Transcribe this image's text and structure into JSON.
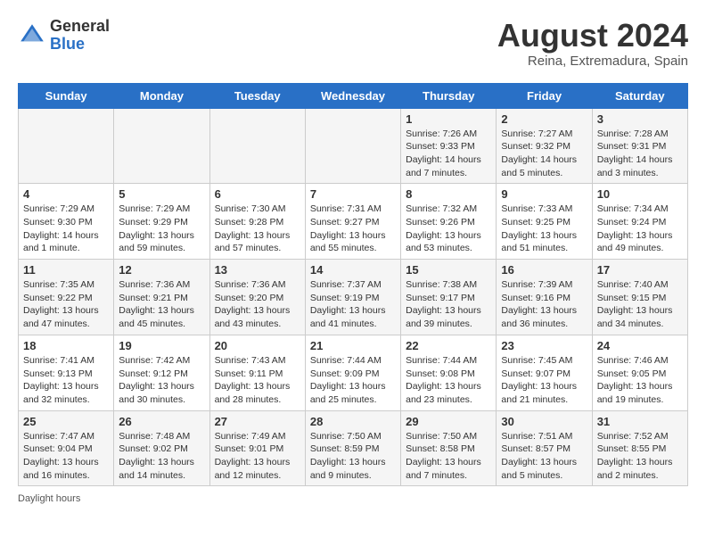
{
  "header": {
    "logo": {
      "general": "General",
      "blue": "Blue"
    },
    "title": "August 2024",
    "location": "Reina, Extremadura, Spain"
  },
  "days_of_week": [
    "Sunday",
    "Monday",
    "Tuesday",
    "Wednesday",
    "Thursday",
    "Friday",
    "Saturday"
  ],
  "weeks": [
    [
      {
        "day": "",
        "info": ""
      },
      {
        "day": "",
        "info": ""
      },
      {
        "day": "",
        "info": ""
      },
      {
        "day": "",
        "info": ""
      },
      {
        "day": "1",
        "info": "Sunrise: 7:26 AM\nSunset: 9:33 PM\nDaylight: 14 hours\nand 7 minutes."
      },
      {
        "day": "2",
        "info": "Sunrise: 7:27 AM\nSunset: 9:32 PM\nDaylight: 14 hours\nand 5 minutes."
      },
      {
        "day": "3",
        "info": "Sunrise: 7:28 AM\nSunset: 9:31 PM\nDaylight: 14 hours\nand 3 minutes."
      }
    ],
    [
      {
        "day": "4",
        "info": "Sunrise: 7:29 AM\nSunset: 9:30 PM\nDaylight: 14 hours\nand 1 minute."
      },
      {
        "day": "5",
        "info": "Sunrise: 7:29 AM\nSunset: 9:29 PM\nDaylight: 13 hours\nand 59 minutes."
      },
      {
        "day": "6",
        "info": "Sunrise: 7:30 AM\nSunset: 9:28 PM\nDaylight: 13 hours\nand 57 minutes."
      },
      {
        "day": "7",
        "info": "Sunrise: 7:31 AM\nSunset: 9:27 PM\nDaylight: 13 hours\nand 55 minutes."
      },
      {
        "day": "8",
        "info": "Sunrise: 7:32 AM\nSunset: 9:26 PM\nDaylight: 13 hours\nand 53 minutes."
      },
      {
        "day": "9",
        "info": "Sunrise: 7:33 AM\nSunset: 9:25 PM\nDaylight: 13 hours\nand 51 minutes."
      },
      {
        "day": "10",
        "info": "Sunrise: 7:34 AM\nSunset: 9:24 PM\nDaylight: 13 hours\nand 49 minutes."
      }
    ],
    [
      {
        "day": "11",
        "info": "Sunrise: 7:35 AM\nSunset: 9:22 PM\nDaylight: 13 hours\nand 47 minutes."
      },
      {
        "day": "12",
        "info": "Sunrise: 7:36 AM\nSunset: 9:21 PM\nDaylight: 13 hours\nand 45 minutes."
      },
      {
        "day": "13",
        "info": "Sunrise: 7:36 AM\nSunset: 9:20 PM\nDaylight: 13 hours\nand 43 minutes."
      },
      {
        "day": "14",
        "info": "Sunrise: 7:37 AM\nSunset: 9:19 PM\nDaylight: 13 hours\nand 41 minutes."
      },
      {
        "day": "15",
        "info": "Sunrise: 7:38 AM\nSunset: 9:17 PM\nDaylight: 13 hours\nand 39 minutes."
      },
      {
        "day": "16",
        "info": "Sunrise: 7:39 AM\nSunset: 9:16 PM\nDaylight: 13 hours\nand 36 minutes."
      },
      {
        "day": "17",
        "info": "Sunrise: 7:40 AM\nSunset: 9:15 PM\nDaylight: 13 hours\nand 34 minutes."
      }
    ],
    [
      {
        "day": "18",
        "info": "Sunrise: 7:41 AM\nSunset: 9:13 PM\nDaylight: 13 hours\nand 32 minutes."
      },
      {
        "day": "19",
        "info": "Sunrise: 7:42 AM\nSunset: 9:12 PM\nDaylight: 13 hours\nand 30 minutes."
      },
      {
        "day": "20",
        "info": "Sunrise: 7:43 AM\nSunset: 9:11 PM\nDaylight: 13 hours\nand 28 minutes."
      },
      {
        "day": "21",
        "info": "Sunrise: 7:44 AM\nSunset: 9:09 PM\nDaylight: 13 hours\nand 25 minutes."
      },
      {
        "day": "22",
        "info": "Sunrise: 7:44 AM\nSunset: 9:08 PM\nDaylight: 13 hours\nand 23 minutes."
      },
      {
        "day": "23",
        "info": "Sunrise: 7:45 AM\nSunset: 9:07 PM\nDaylight: 13 hours\nand 21 minutes."
      },
      {
        "day": "24",
        "info": "Sunrise: 7:46 AM\nSunset: 9:05 PM\nDaylight: 13 hours\nand 19 minutes."
      }
    ],
    [
      {
        "day": "25",
        "info": "Sunrise: 7:47 AM\nSunset: 9:04 PM\nDaylight: 13 hours\nand 16 minutes."
      },
      {
        "day": "26",
        "info": "Sunrise: 7:48 AM\nSunset: 9:02 PM\nDaylight: 13 hours\nand 14 minutes."
      },
      {
        "day": "27",
        "info": "Sunrise: 7:49 AM\nSunset: 9:01 PM\nDaylight: 13 hours\nand 12 minutes."
      },
      {
        "day": "28",
        "info": "Sunrise: 7:50 AM\nSunset: 8:59 PM\nDaylight: 13 hours\nand 9 minutes."
      },
      {
        "day": "29",
        "info": "Sunrise: 7:50 AM\nSunset: 8:58 PM\nDaylight: 13 hours\nand 7 minutes."
      },
      {
        "day": "30",
        "info": "Sunrise: 7:51 AM\nSunset: 8:57 PM\nDaylight: 13 hours\nand 5 minutes."
      },
      {
        "day": "31",
        "info": "Sunrise: 7:52 AM\nSunset: 8:55 PM\nDaylight: 13 hours\nand 2 minutes."
      }
    ]
  ],
  "footer": {
    "daylight_label": "Daylight hours"
  }
}
